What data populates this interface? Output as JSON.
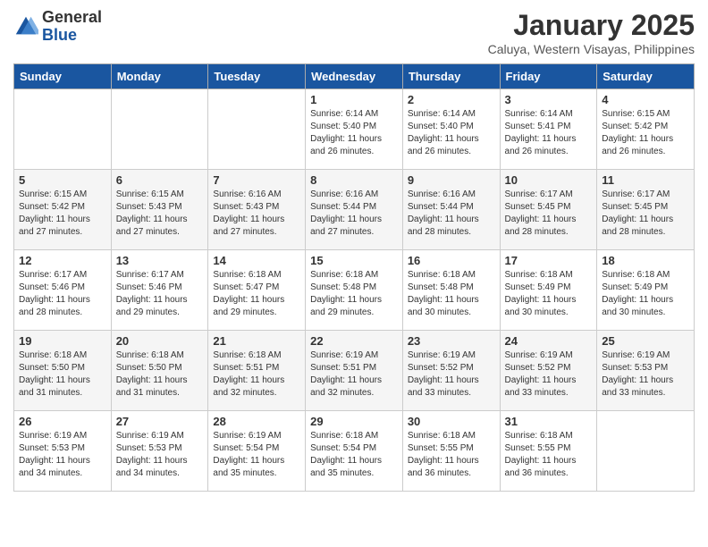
{
  "logo": {
    "line1": "General",
    "line2": "Blue"
  },
  "header": {
    "title": "January 2025",
    "location": "Caluya, Western Visayas, Philippines"
  },
  "weekdays": [
    "Sunday",
    "Monday",
    "Tuesday",
    "Wednesday",
    "Thursday",
    "Friday",
    "Saturday"
  ],
  "weeks": [
    [
      {
        "day": "",
        "info": ""
      },
      {
        "day": "",
        "info": ""
      },
      {
        "day": "",
        "info": ""
      },
      {
        "day": "1",
        "info": "Sunrise: 6:14 AM\nSunset: 5:40 PM\nDaylight: 11 hours and 26 minutes."
      },
      {
        "day": "2",
        "info": "Sunrise: 6:14 AM\nSunset: 5:40 PM\nDaylight: 11 hours and 26 minutes."
      },
      {
        "day": "3",
        "info": "Sunrise: 6:14 AM\nSunset: 5:41 PM\nDaylight: 11 hours and 26 minutes."
      },
      {
        "day": "4",
        "info": "Sunrise: 6:15 AM\nSunset: 5:42 PM\nDaylight: 11 hours and 26 minutes."
      }
    ],
    [
      {
        "day": "5",
        "info": "Sunrise: 6:15 AM\nSunset: 5:42 PM\nDaylight: 11 hours and 27 minutes."
      },
      {
        "day": "6",
        "info": "Sunrise: 6:15 AM\nSunset: 5:43 PM\nDaylight: 11 hours and 27 minutes."
      },
      {
        "day": "7",
        "info": "Sunrise: 6:16 AM\nSunset: 5:43 PM\nDaylight: 11 hours and 27 minutes."
      },
      {
        "day": "8",
        "info": "Sunrise: 6:16 AM\nSunset: 5:44 PM\nDaylight: 11 hours and 27 minutes."
      },
      {
        "day": "9",
        "info": "Sunrise: 6:16 AM\nSunset: 5:44 PM\nDaylight: 11 hours and 28 minutes."
      },
      {
        "day": "10",
        "info": "Sunrise: 6:17 AM\nSunset: 5:45 PM\nDaylight: 11 hours and 28 minutes."
      },
      {
        "day": "11",
        "info": "Sunrise: 6:17 AM\nSunset: 5:45 PM\nDaylight: 11 hours and 28 minutes."
      }
    ],
    [
      {
        "day": "12",
        "info": "Sunrise: 6:17 AM\nSunset: 5:46 PM\nDaylight: 11 hours and 28 minutes."
      },
      {
        "day": "13",
        "info": "Sunrise: 6:17 AM\nSunset: 5:46 PM\nDaylight: 11 hours and 29 minutes."
      },
      {
        "day": "14",
        "info": "Sunrise: 6:18 AM\nSunset: 5:47 PM\nDaylight: 11 hours and 29 minutes."
      },
      {
        "day": "15",
        "info": "Sunrise: 6:18 AM\nSunset: 5:48 PM\nDaylight: 11 hours and 29 minutes."
      },
      {
        "day": "16",
        "info": "Sunrise: 6:18 AM\nSunset: 5:48 PM\nDaylight: 11 hours and 30 minutes."
      },
      {
        "day": "17",
        "info": "Sunrise: 6:18 AM\nSunset: 5:49 PM\nDaylight: 11 hours and 30 minutes."
      },
      {
        "day": "18",
        "info": "Sunrise: 6:18 AM\nSunset: 5:49 PM\nDaylight: 11 hours and 30 minutes."
      }
    ],
    [
      {
        "day": "19",
        "info": "Sunrise: 6:18 AM\nSunset: 5:50 PM\nDaylight: 11 hours and 31 minutes."
      },
      {
        "day": "20",
        "info": "Sunrise: 6:18 AM\nSunset: 5:50 PM\nDaylight: 11 hours and 31 minutes."
      },
      {
        "day": "21",
        "info": "Sunrise: 6:18 AM\nSunset: 5:51 PM\nDaylight: 11 hours and 32 minutes."
      },
      {
        "day": "22",
        "info": "Sunrise: 6:19 AM\nSunset: 5:51 PM\nDaylight: 11 hours and 32 minutes."
      },
      {
        "day": "23",
        "info": "Sunrise: 6:19 AM\nSunset: 5:52 PM\nDaylight: 11 hours and 33 minutes."
      },
      {
        "day": "24",
        "info": "Sunrise: 6:19 AM\nSunset: 5:52 PM\nDaylight: 11 hours and 33 minutes."
      },
      {
        "day": "25",
        "info": "Sunrise: 6:19 AM\nSunset: 5:53 PM\nDaylight: 11 hours and 33 minutes."
      }
    ],
    [
      {
        "day": "26",
        "info": "Sunrise: 6:19 AM\nSunset: 5:53 PM\nDaylight: 11 hours and 34 minutes."
      },
      {
        "day": "27",
        "info": "Sunrise: 6:19 AM\nSunset: 5:53 PM\nDaylight: 11 hours and 34 minutes."
      },
      {
        "day": "28",
        "info": "Sunrise: 6:19 AM\nSunset: 5:54 PM\nDaylight: 11 hours and 35 minutes."
      },
      {
        "day": "29",
        "info": "Sunrise: 6:18 AM\nSunset: 5:54 PM\nDaylight: 11 hours and 35 minutes."
      },
      {
        "day": "30",
        "info": "Sunrise: 6:18 AM\nSunset: 5:55 PM\nDaylight: 11 hours and 36 minutes."
      },
      {
        "day": "31",
        "info": "Sunrise: 6:18 AM\nSunset: 5:55 PM\nDaylight: 11 hours and 36 minutes."
      },
      {
        "day": "",
        "info": ""
      }
    ]
  ]
}
